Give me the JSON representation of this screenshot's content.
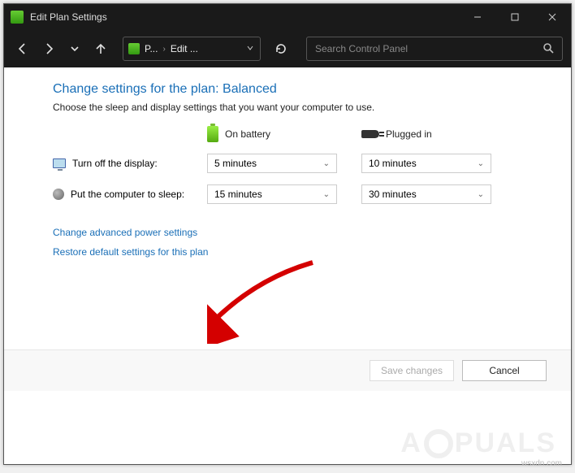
{
  "window": {
    "title": "Edit Plan Settings"
  },
  "nav": {
    "crumb1": "P...",
    "crumb2": "Edit ...",
    "search_placeholder": "Search Control Panel"
  },
  "page": {
    "title": "Change settings for the plan: Balanced",
    "subtitle": "Choose the sleep and display settings that you want your computer to use."
  },
  "columns": {
    "battery": "On battery",
    "plugged": "Plugged in"
  },
  "rows": {
    "display_label": "Turn off the display:",
    "sleep_label": "Put the computer to sleep:"
  },
  "values": {
    "display_battery": "5 minutes",
    "display_plugged": "10 minutes",
    "sleep_battery": "15 minutes",
    "sleep_plugged": "30 minutes"
  },
  "links": {
    "advanced": "Change advanced power settings",
    "restore": "Restore default settings for this plan"
  },
  "buttons": {
    "save": "Save changes",
    "cancel": "Cancel"
  },
  "watermark": {
    "pre": "A",
    "post": "PUALS",
    "site": "wsxdn.com"
  }
}
